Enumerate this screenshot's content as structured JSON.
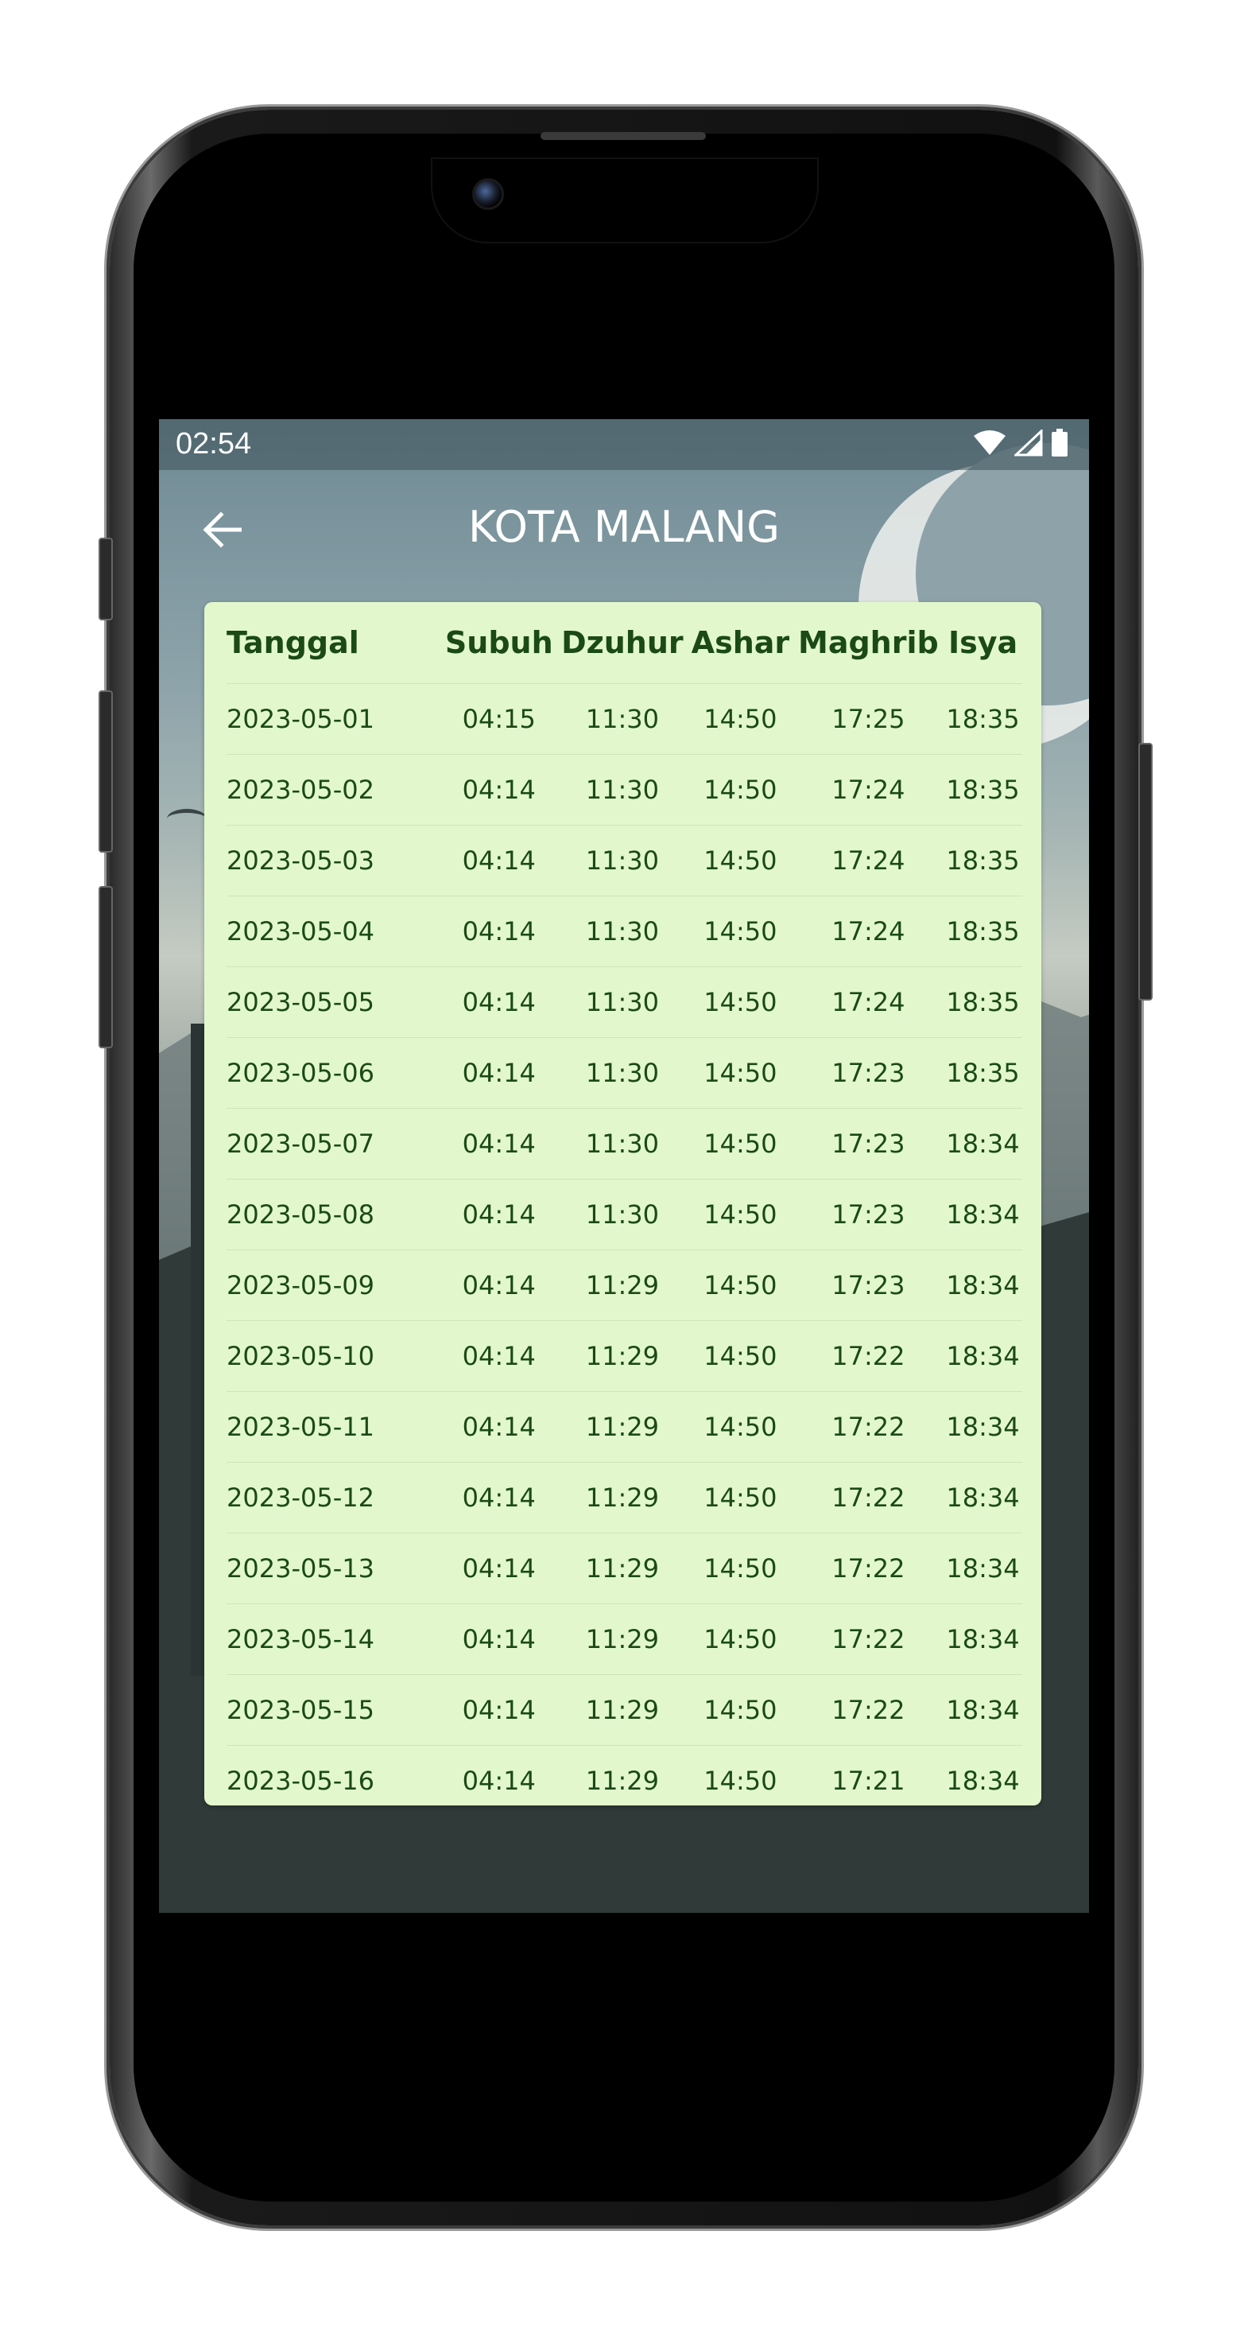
{
  "status_bar": {
    "time": "02:54",
    "icons": [
      "wifi-icon",
      "signal-icon",
      "battery-icon"
    ]
  },
  "app_bar": {
    "back_icon": "arrow-left-icon",
    "title": "KOTA MALANG"
  },
  "colors": {
    "card_background": "#e2f8cc",
    "table_text": "#1b4a14",
    "title_text": "#ffffff"
  },
  "table": {
    "headers": {
      "date": "Tanggal",
      "subuh": "Subuh",
      "dzuhur": "Dzuhur",
      "ashar": "Ashar",
      "maghrib": "Maghrib",
      "isya": "Isya"
    },
    "rows": [
      {
        "date": "2023-05-01",
        "subuh": "04:15",
        "dzuhur": "11:30",
        "ashar": "14:50",
        "maghrib": "17:25",
        "isya": "18:35"
      },
      {
        "date": "2023-05-02",
        "subuh": "04:14",
        "dzuhur": "11:30",
        "ashar": "14:50",
        "maghrib": "17:24",
        "isya": "18:35"
      },
      {
        "date": "2023-05-03",
        "subuh": "04:14",
        "dzuhur": "11:30",
        "ashar": "14:50",
        "maghrib": "17:24",
        "isya": "18:35"
      },
      {
        "date": "2023-05-04",
        "subuh": "04:14",
        "dzuhur": "11:30",
        "ashar": "14:50",
        "maghrib": "17:24",
        "isya": "18:35"
      },
      {
        "date": "2023-05-05",
        "subuh": "04:14",
        "dzuhur": "11:30",
        "ashar": "14:50",
        "maghrib": "17:24",
        "isya": "18:35"
      },
      {
        "date": "2023-05-06",
        "subuh": "04:14",
        "dzuhur": "11:30",
        "ashar": "14:50",
        "maghrib": "17:23",
        "isya": "18:35"
      },
      {
        "date": "2023-05-07",
        "subuh": "04:14",
        "dzuhur": "11:30",
        "ashar": "14:50",
        "maghrib": "17:23",
        "isya": "18:34"
      },
      {
        "date": "2023-05-08",
        "subuh": "04:14",
        "dzuhur": "11:30",
        "ashar": "14:50",
        "maghrib": "17:23",
        "isya": "18:34"
      },
      {
        "date": "2023-05-09",
        "subuh": "04:14",
        "dzuhur": "11:29",
        "ashar": "14:50",
        "maghrib": "17:23",
        "isya": "18:34"
      },
      {
        "date": "2023-05-10",
        "subuh": "04:14",
        "dzuhur": "11:29",
        "ashar": "14:50",
        "maghrib": "17:22",
        "isya": "18:34"
      },
      {
        "date": "2023-05-11",
        "subuh": "04:14",
        "dzuhur": "11:29",
        "ashar": "14:50",
        "maghrib": "17:22",
        "isya": "18:34"
      },
      {
        "date": "2023-05-12",
        "subuh": "04:14",
        "dzuhur": "11:29",
        "ashar": "14:50",
        "maghrib": "17:22",
        "isya": "18:34"
      },
      {
        "date": "2023-05-13",
        "subuh": "04:14",
        "dzuhur": "11:29",
        "ashar": "14:50",
        "maghrib": "17:22",
        "isya": "18:34"
      },
      {
        "date": "2023-05-14",
        "subuh": "04:14",
        "dzuhur": "11:29",
        "ashar": "14:50",
        "maghrib": "17:22",
        "isya": "18:34"
      },
      {
        "date": "2023-05-15",
        "subuh": "04:14",
        "dzuhur": "11:29",
        "ashar": "14:50",
        "maghrib": "17:22",
        "isya": "18:34"
      },
      {
        "date": "2023-05-16",
        "subuh": "04:14",
        "dzuhur": "11:29",
        "ashar": "14:50",
        "maghrib": "17:21",
        "isya": "18:34"
      }
    ]
  }
}
